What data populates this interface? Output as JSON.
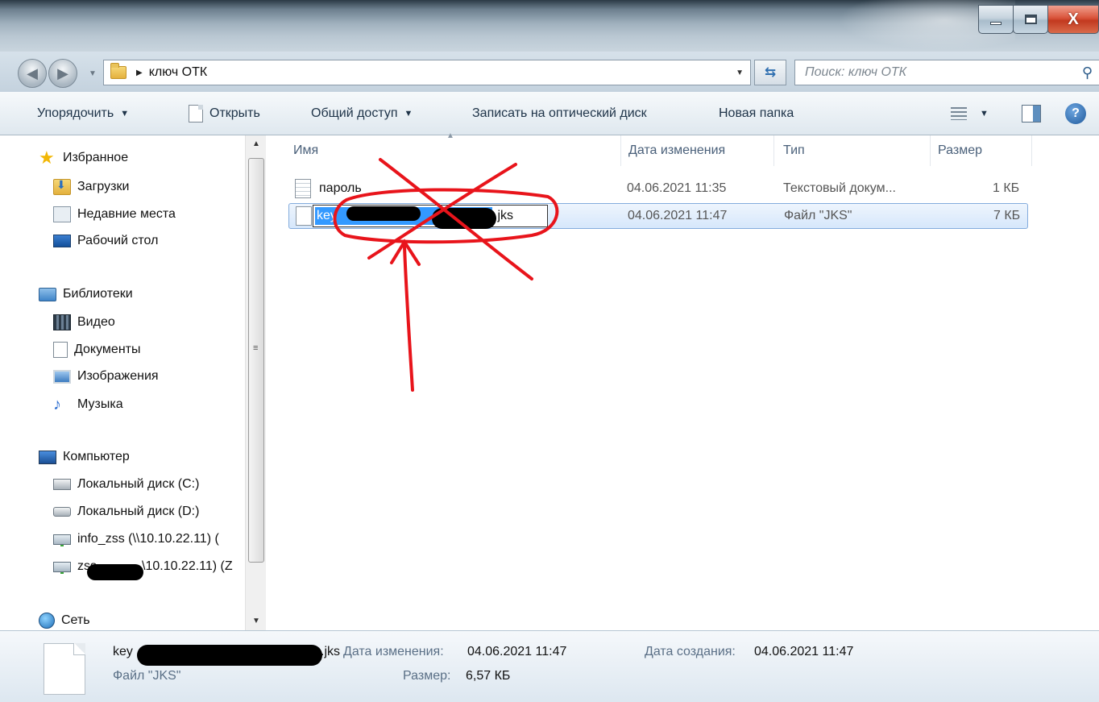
{
  "window": {
    "minimize_glyph": "–",
    "maximize_glyph": "□",
    "close_glyph": "X"
  },
  "address": {
    "crumb": "ключ ОТК",
    "search_placeholder": "Поиск: ключ ОТК"
  },
  "toolbar": {
    "organize": "Упорядочить",
    "open": "Открыть",
    "share": "Общий доступ",
    "burn": "Записать на оптический диск",
    "new_folder": "Новая папка"
  },
  "nav": {
    "favorites": "Избранное",
    "downloads": "Загрузки",
    "recent": "Недавние места",
    "desktop": "Рабочий стол",
    "libraries": "Библиотеки",
    "video": "Видео",
    "documents": "Документы",
    "pictures": "Изображения",
    "music": "Музыка",
    "computer": "Компьютер",
    "disk_c": "Локальный диск (C:)",
    "disk_d": "Локальный диск (D:)",
    "net1": "info_zss (\\\\10.10.22.11) (",
    "net2_prefix": "zss",
    "net2_suffix": "\\10.10.22.11) (Z",
    "network": "Сеть"
  },
  "columns": {
    "name": "Имя",
    "date": "Дата изменения",
    "type": "Тип",
    "size": "Размер"
  },
  "files": [
    {
      "name": "пароль",
      "date": "04.06.2021 11:35",
      "type": "Текстовый докум...",
      "size": "1 КБ"
    },
    {
      "name_visible_prefix": "key",
      "name_visible_suffix": ".jks",
      "date": "04.06.2021 11:47",
      "type": "Файл \"JKS\"",
      "size": "7 КБ"
    }
  ],
  "details": {
    "name_prefix": "key",
    "name_suffix": ".jks",
    "type": "Файл \"JKS\"",
    "modified_label": "Дата изменения:",
    "modified_value": "04.06.2021 11:47",
    "size_label": "Размер:",
    "size_value": "6,57 КБ",
    "created_label": "Дата создания:",
    "created_value": "04.06.2021 11:47"
  },
  "colors": {
    "annotation_red": "#e8141b",
    "selection_blue": "#3399ff"
  }
}
